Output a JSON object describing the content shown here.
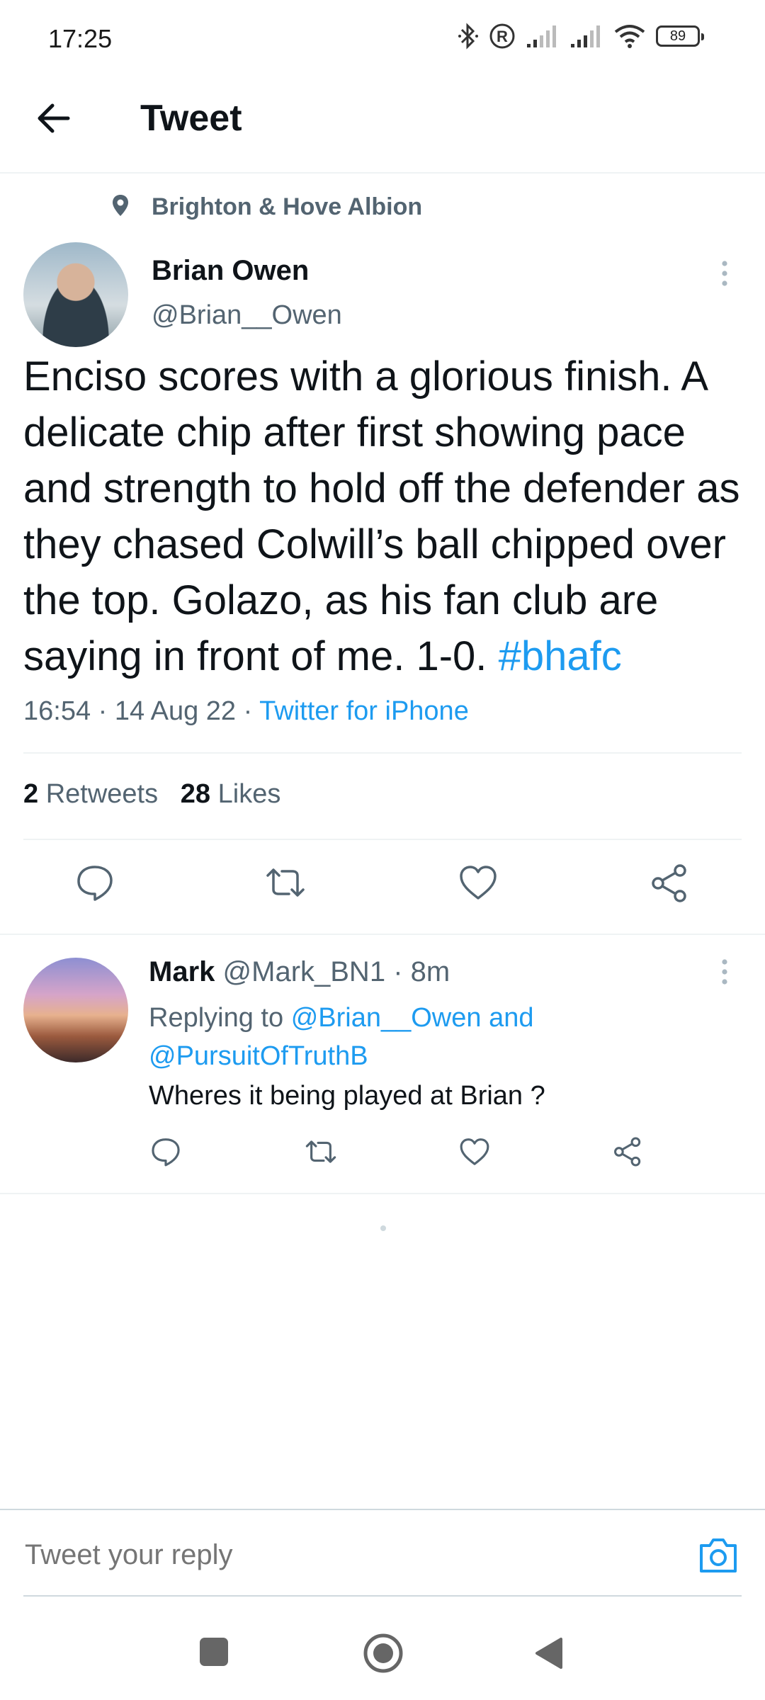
{
  "status_bar": {
    "time": "17:25",
    "battery": "89",
    "icons": [
      "bluetooth-icon",
      "registered-icon",
      "signal-icon",
      "signal-icon",
      "wifi-icon",
      "battery-icon"
    ]
  },
  "header": {
    "title": "Tweet"
  },
  "tweet": {
    "location": "Brighton & Hove Albion",
    "author_name": "Brian Owen",
    "author_handle": "@Brian__Owen",
    "text": "Enciso scores with a glorious finish. A delicate chip after first showing pace and strength to hold off the defender as they chased Colwill’s ball chipped over the top. Golazo, as his fan club are saying in front of me. 1-0.",
    "hashtag": "#bhafc",
    "time": "16:54",
    "date": "14 Aug 22",
    "source": "Twitter for iPhone",
    "retweets_count": "2",
    "retweets_label": "Retweets",
    "likes_count": "28",
    "likes_label": "Likes"
  },
  "reply": {
    "name": "Mark",
    "handle": "@Mark_BN1",
    "age": "8m",
    "replying_prefix": "Replying to",
    "mention1": "@Brian__Owen",
    "conjunction": "and",
    "mention2": "@PursuitOfTruthB",
    "text": "Wheres it being played at Brian ?"
  },
  "compose": {
    "placeholder": "Tweet your reply"
  },
  "colors": {
    "accent": "#1d9bf0",
    "secondary_text": "#536471",
    "primary_text": "#0f1419",
    "divider": "#eff3f4"
  }
}
